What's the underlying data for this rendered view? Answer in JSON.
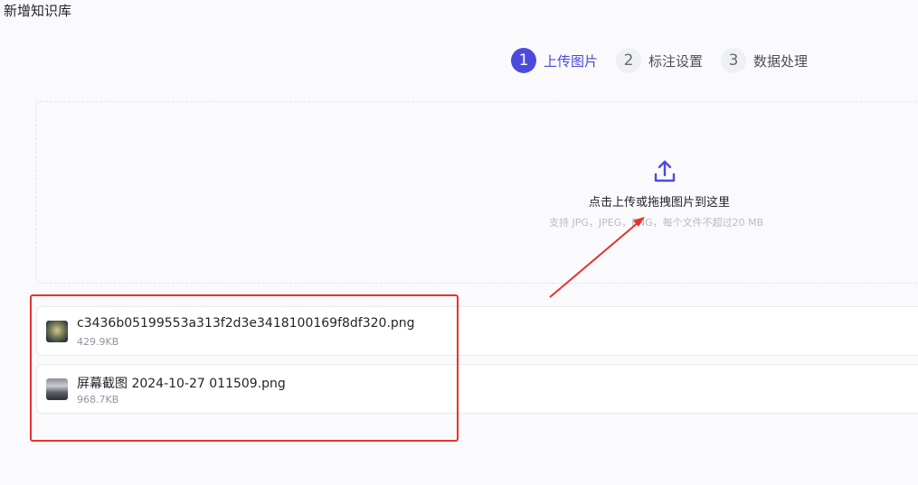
{
  "page": {
    "title": "新增知识库"
  },
  "steps": [
    {
      "number": "1",
      "label": "上传图片",
      "state": "active"
    },
    {
      "number": "2",
      "label": "标注设置",
      "state": "inactive"
    },
    {
      "number": "3",
      "label": "数据处理",
      "state": "inactive"
    }
  ],
  "upload": {
    "icon": "upload-icon",
    "text": "点击上传或拖拽图片到这里",
    "hint": "支持 JPG，JPEG，PNG，每个文件不超过20 MB"
  },
  "files": [
    {
      "name": "c3436b05199553a313f2d3e3418100169f8df320.png",
      "size": "429.9KB"
    },
    {
      "name": "屏幕截图 2024-10-27 011509.png",
      "size": "968.7KB"
    }
  ],
  "colors": {
    "accent": "#4b4bdb",
    "annotation": "#e8322d"
  }
}
